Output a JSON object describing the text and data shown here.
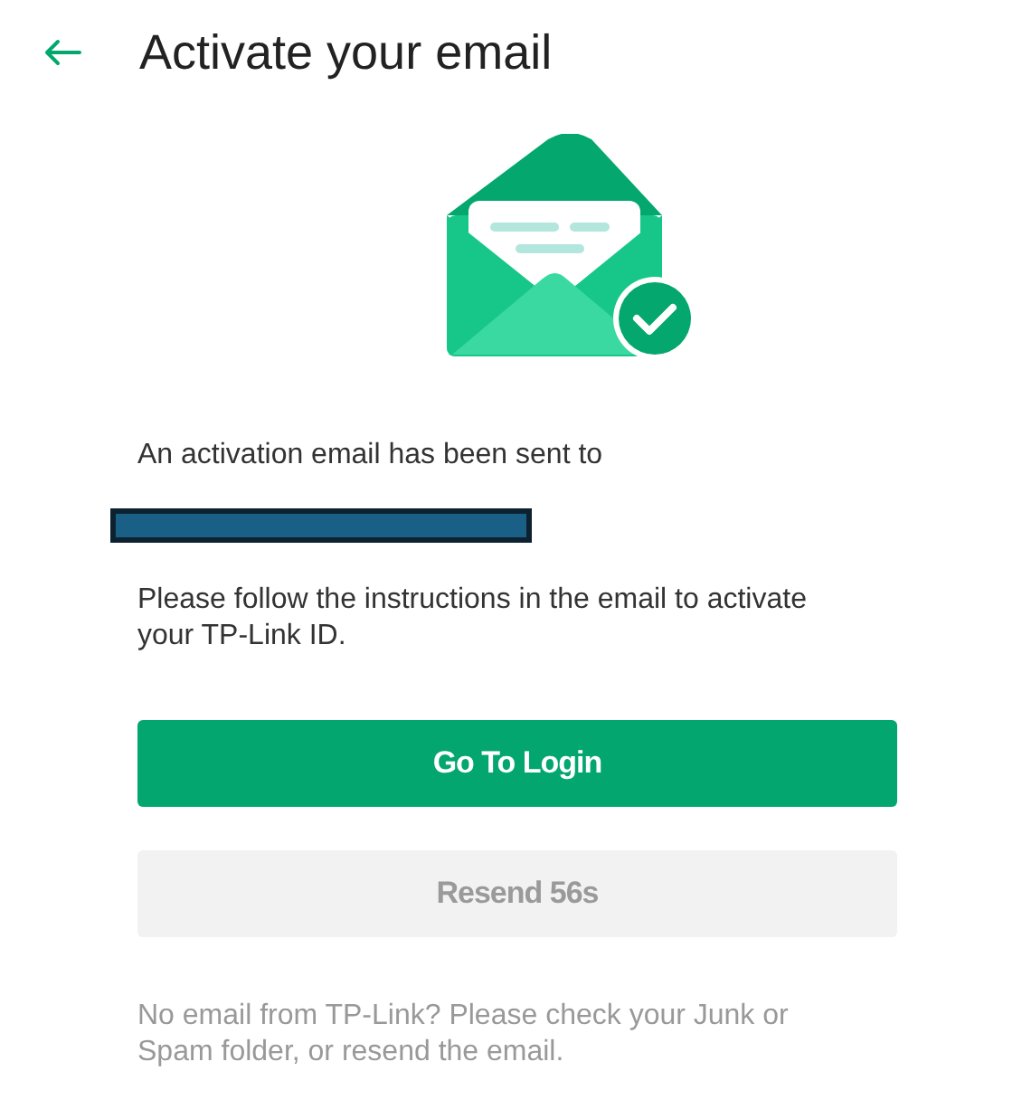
{
  "header": {
    "title": "Activate your email"
  },
  "message": "An activation email has been sent to",
  "email": {
    "redacted": true
  },
  "instructions": "Please follow the instructions in the email to activate your TP-Link ID.",
  "buttons": [
    {
      "label": "Go To Login",
      "kind": "primary",
      "disabled": false
    },
    {
      "label": "Resend 56s",
      "kind": "secondary",
      "disabled": true
    }
  ],
  "help_text": "No email from TP-Link? Please check your Junk or Spam folder, or resend the email."
}
